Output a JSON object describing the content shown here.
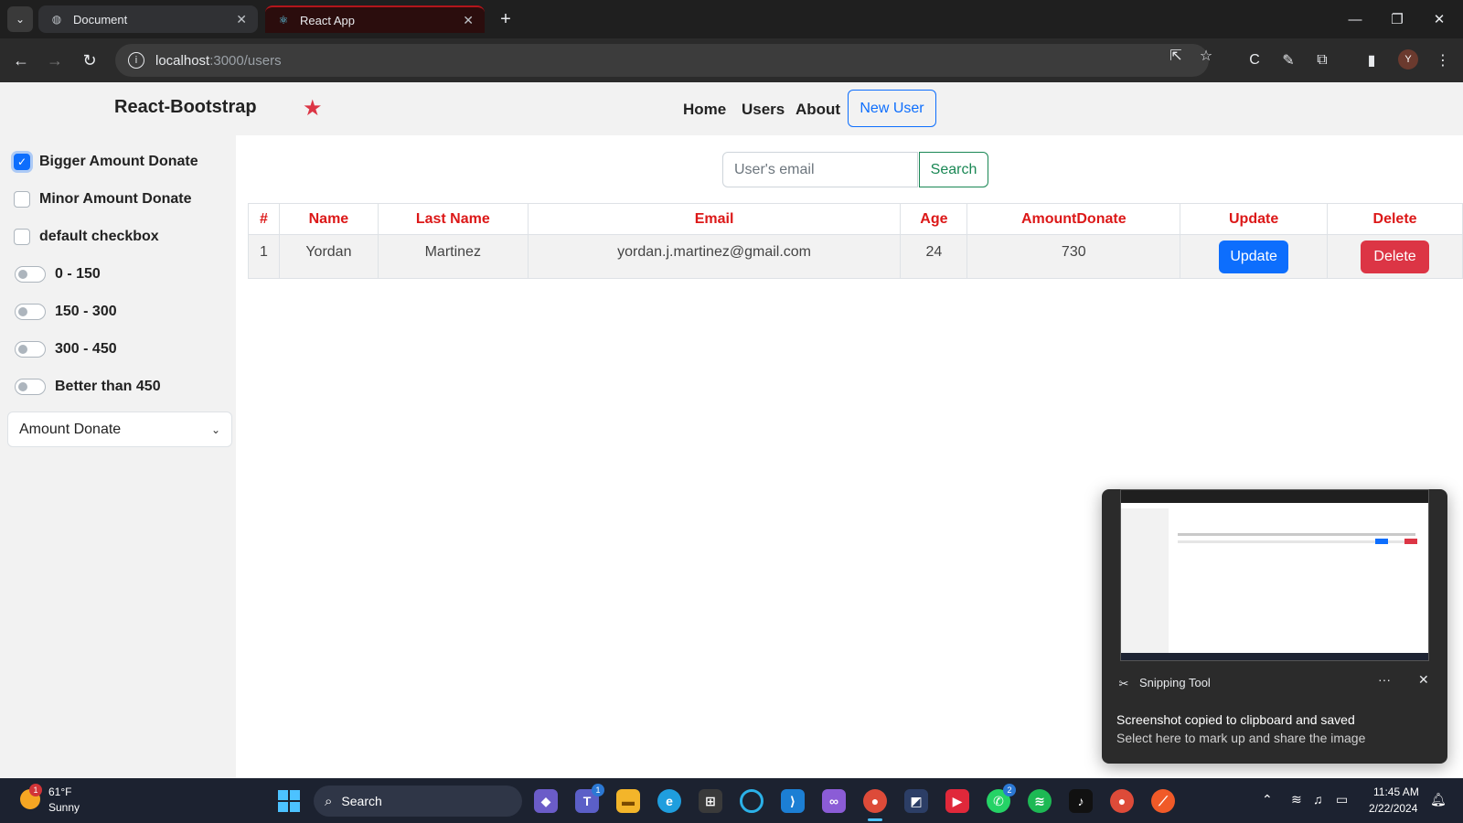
{
  "browser": {
    "tabs": [
      {
        "title": "Document",
        "active": false
      },
      {
        "title": "React App",
        "active": true
      }
    ],
    "url_host": "localhost",
    "url_path": ":3000/users",
    "profile_initial": "Y"
  },
  "navbar": {
    "brand": "React-Bootstrap",
    "links": [
      "Home",
      "Users",
      "About"
    ],
    "new_user_label": "New User"
  },
  "sidebar": {
    "checkboxes": [
      {
        "label": "Bigger Amount Donate",
        "checked": true
      },
      {
        "label": "Minor Amount Donate",
        "checked": false
      },
      {
        "label": "default checkbox",
        "checked": false
      }
    ],
    "switches": [
      {
        "label": "0 - 150",
        "on": false
      },
      {
        "label": "150 - 300",
        "on": false
      },
      {
        "label": "300 - 450",
        "on": false
      },
      {
        "label": "Better than 450",
        "on": false
      }
    ],
    "select_value": "Amount Donate"
  },
  "search": {
    "placeholder": "User's email",
    "button_label": "Search"
  },
  "table": {
    "headers": [
      "#",
      "Name",
      "Last Name",
      "Email",
      "Age",
      "AmountDonate",
      "Update",
      "Delete"
    ],
    "rows": [
      {
        "id": "1",
        "name": "Yordan",
        "last_name": "Martinez",
        "email": "yordan.j.martinez@gmail.com",
        "age": "24",
        "amount": "730",
        "update_label": "Update",
        "delete_label": "Delete"
      }
    ]
  },
  "toast": {
    "app_name": "Snipping Tool",
    "title": "Screenshot copied to clipboard and saved",
    "message": "Select here to mark up and share the image",
    "more": "···"
  },
  "taskbar": {
    "weather_temp": "61°F",
    "weather_cond": "Sunny",
    "weather_badge": "1",
    "search_label": "Search",
    "teams_badge": "1",
    "whatsapp_badge": "2",
    "time": "11:45 AM",
    "date": "2/22/2024"
  },
  "colors": {
    "accent": "#0d6efd",
    "danger": "#dc3545",
    "success": "#198754",
    "header_red": "#dc1818"
  }
}
